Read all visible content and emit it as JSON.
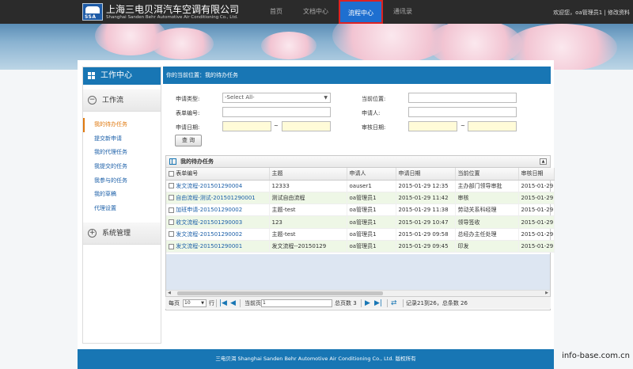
{
  "header": {
    "logo_text": "SSA",
    "company_cn": "上海三电贝洱汽车空调有限公司",
    "company_en": "Shanghai Sanden Behr Automotive Air Conditioning Co., Ltd.",
    "nav": [
      "首页",
      "文档中心",
      "流程中心",
      "通讯录"
    ],
    "welcome": "欢迎您，oa管理员1 | 修改资料"
  },
  "sidebar": {
    "title": "工作中心",
    "section1": "工作流",
    "items": [
      "我的待办任务",
      "提交新申请",
      "我的代理任务",
      "我提交的任务",
      "我参与的任务",
      "我的草稿",
      "代理设置"
    ],
    "section2": "系统管理"
  },
  "breadcrumb": "你的当前位置：我的待办任务",
  "form": {
    "type_label": "申请类型:",
    "type_value": "-Select All-",
    "position_label": "当前位置:",
    "form_no_label": "表单编号:",
    "applicant_label": "申请人:",
    "apply_date_label": "申请日期:",
    "review_date_label": "审核日期:",
    "tilde": "~",
    "query_button": "查 询"
  },
  "grid": {
    "title": "我的待办任务",
    "columns": [
      "表单编号",
      "主题",
      "申请人",
      "申请日期",
      "当前位置",
      "审核日期"
    ],
    "rows": [
      [
        "发文流程-201501290004",
        "12333",
        "oauser1",
        "2015-01-29 12:35",
        "主办部门领导审批",
        "2015-01-29"
      ],
      [
        "自由流程-测试-201501290001",
        "测试自由流程",
        "oa管理员1",
        "2015-01-29 11:42",
        "审核",
        "2015-01-29"
      ],
      [
        "加班申请-201501290002",
        "主题-test",
        "oa管理员1",
        "2015-01-29 11:38",
        "劳动关系科经理",
        "2015-01-29"
      ],
      [
        "收文流程-201501290003",
        "123",
        "oa管理员1",
        "2015-01-29 10:47",
        "领导签收",
        "2015-01-29"
      ],
      [
        "发文流程-201501290002",
        "主题-test",
        "oa管理员1",
        "2015-01-29 09:58",
        "总经办主任处理",
        "2015-01-29"
      ],
      [
        "发文流程-201501290001",
        "发文流程--20150129",
        "oa管理员1",
        "2015-01-29 09:45",
        "印发",
        "2015-01-29"
      ]
    ]
  },
  "pager": {
    "per_page_label": "每页",
    "per_page_value": "10",
    "row_unit": "行",
    "current_label": "当前页",
    "current_value": "1",
    "total_pages": "总页数 3",
    "record_info": "记录21到26，总条数 26"
  },
  "footer": "三电贝洱 Shanghai Sanden Behr Automotive Air Conditioning Co., Ltd. 版权所有",
  "watermark": "info-base.com.cn"
}
